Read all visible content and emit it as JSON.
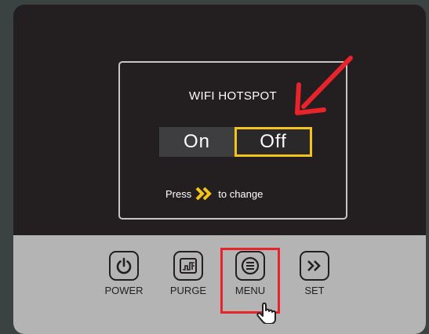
{
  "screen": {
    "title": "WIFI HOTSPOT",
    "options": {
      "on": "On",
      "off": "Off"
    },
    "selected": "Off",
    "hint_before": "Press",
    "hint_after": "to change"
  },
  "buttons": [
    {
      "label": "POWER",
      "icon": "power-icon"
    },
    {
      "label": "PURGE",
      "icon": "purge-icon"
    },
    {
      "label": "MENU",
      "icon": "menu-icon",
      "highlighted": true
    },
    {
      "label": "SET",
      "icon": "chevron-right-icon"
    }
  ],
  "colors": {
    "background": "#3a4341",
    "device": "#231f20",
    "panel": "#b4b4b4",
    "accent_yellow": "#f3c31a",
    "annotation_red": "#e8232a"
  }
}
